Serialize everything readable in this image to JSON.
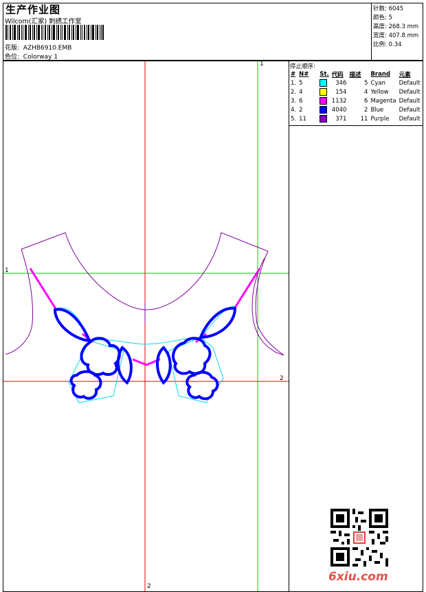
{
  "header": {
    "title": "生产作业图",
    "subtitle": "Wilcom(汇家) 刺绣工作室",
    "design_label": "花版:",
    "design_value": "AZHB6910.EMB",
    "colorway_label": "色位:",
    "colorway_value": "Colorway 1"
  },
  "stats": {
    "stitches_label": "针数:",
    "stitches_value": "6045",
    "colors_label": "颜色:",
    "colors_value": "5",
    "height_label": "高度:",
    "height_value": "268.3 mm",
    "width_label": "宽度:",
    "width_value": "407.8 mm",
    "scale_label": "比例:",
    "scale_value": "0.34"
  },
  "sequence": {
    "title": "停止顺序:",
    "headers": [
      "#",
      "N#",
      "St.",
      "代码",
      "描述",
      "Brand",
      "元素"
    ],
    "rows": [
      {
        "idx": "1.",
        "n": "5",
        "st": "346",
        "code": "5",
        "desc": "Cyan",
        "brand": "Default",
        "color": "#00ffff"
      },
      {
        "idx": "2.",
        "n": "4",
        "st": "154",
        "code": "4",
        "desc": "Yellow",
        "brand": "Default",
        "color": "#ffff00"
      },
      {
        "idx": "3.",
        "n": "6",
        "st": "1132",
        "code": "6",
        "desc": "Magenta",
        "brand": "Default",
        "color": "#ff00ff"
      },
      {
        "idx": "4.",
        "n": "2",
        "st": "4040",
        "code": "2",
        "desc": "Blue",
        "brand": "Default",
        "color": "#0000ff"
      },
      {
        "idx": "5.",
        "n": "11",
        "st": "371",
        "code": "11",
        "desc": "Purple",
        "brand": "Default",
        "color": "#8000c0"
      }
    ]
  },
  "axes": {
    "green_v": "1",
    "green_h": "1",
    "red_h": "2",
    "red_v": "2"
  },
  "watermark": "6xiu.com"
}
